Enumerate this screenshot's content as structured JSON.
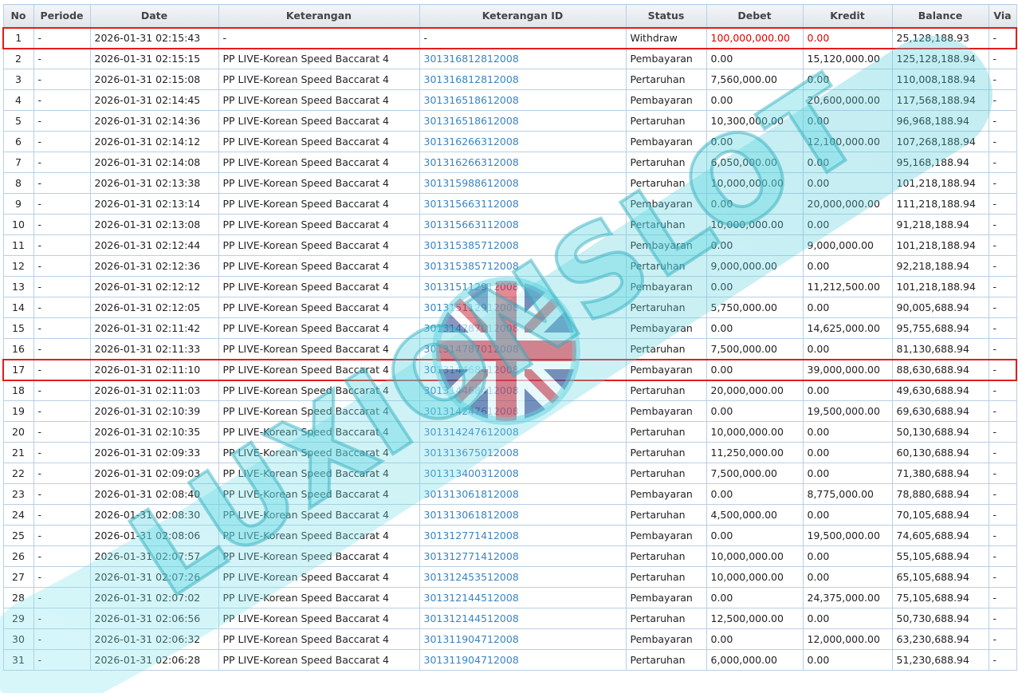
{
  "columns": [
    "No",
    "Periode",
    "Date",
    "Keterangan",
    "Keterangan ID",
    "Status",
    "Debet",
    "Kredit",
    "Balance",
    "Via"
  ],
  "highlight_color": "#e31c1c",
  "link_color": "#3a84c4",
  "watermark_text": "LUXIONSLOT",
  "rows": [
    {
      "no": "1",
      "periode": "-",
      "date": "2026-01-31 02:15:43",
      "ket": "-",
      "ket_id": "-",
      "status": "Withdraw",
      "debet": "100,000,000.00",
      "kredit": "0.00",
      "balance": "25,128,188.93",
      "via": "-",
      "highlight": true,
      "red": true
    },
    {
      "no": "2",
      "periode": "-",
      "date": "2026-01-31 02:15:15",
      "ket": "PP LIVE-Korean Speed Baccarat 4",
      "ket_id": "301316812812008",
      "status": "Pembayaran",
      "debet": "0.00",
      "kredit": "15,120,000.00",
      "balance": "125,128,188.94",
      "via": "-"
    },
    {
      "no": "3",
      "periode": "-",
      "date": "2026-01-31 02:15:08",
      "ket": "PP LIVE-Korean Speed Baccarat 4",
      "ket_id": "301316812812008",
      "status": "Pertaruhan",
      "debet": "7,560,000.00",
      "kredit": "0.00",
      "balance": "110,008,188.94",
      "via": "-"
    },
    {
      "no": "4",
      "periode": "-",
      "date": "2026-01-31 02:14:45",
      "ket": "PP LIVE-Korean Speed Baccarat 4",
      "ket_id": "301316518612008",
      "status": "Pembayaran",
      "debet": "0.00",
      "kredit": "20,600,000.00",
      "balance": "117,568,188.94",
      "via": "-"
    },
    {
      "no": "5",
      "periode": "-",
      "date": "2026-01-31 02:14:36",
      "ket": "PP LIVE-Korean Speed Baccarat 4",
      "ket_id": "301316518612008",
      "status": "Pertaruhan",
      "debet": "10,300,000.00",
      "kredit": "0.00",
      "balance": "96,968,188.94",
      "via": "-"
    },
    {
      "no": "6",
      "periode": "-",
      "date": "2026-01-31 02:14:12",
      "ket": "PP LIVE-Korean Speed Baccarat 4",
      "ket_id": "301316266312008",
      "status": "Pembayaran",
      "debet": "0.00",
      "kredit": "12,100,000.00",
      "balance": "107,268,188.94",
      "via": "-"
    },
    {
      "no": "7",
      "periode": "-",
      "date": "2026-01-31 02:14:08",
      "ket": "PP LIVE-Korean Speed Baccarat 4",
      "ket_id": "301316266312008",
      "status": "Pertaruhan",
      "debet": "6,050,000.00",
      "kredit": "0.00",
      "balance": "95,168,188.94",
      "via": "-"
    },
    {
      "no": "8",
      "periode": "-",
      "date": "2026-01-31 02:13:38",
      "ket": "PP LIVE-Korean Speed Baccarat 4",
      "ket_id": "301315988612008",
      "status": "Pertaruhan",
      "debet": "10,000,000.00",
      "kredit": "0.00",
      "balance": "101,218,188.94",
      "via": "-"
    },
    {
      "no": "9",
      "periode": "-",
      "date": "2026-01-31 02:13:14",
      "ket": "PP LIVE-Korean Speed Baccarat 4",
      "ket_id": "301315663112008",
      "status": "Pembayaran",
      "debet": "0.00",
      "kredit": "20,000,000.00",
      "balance": "111,218,188.94",
      "via": "-"
    },
    {
      "no": "10",
      "periode": "-",
      "date": "2026-01-31 02:13:08",
      "ket": "PP LIVE-Korean Speed Baccarat 4",
      "ket_id": "301315663112008",
      "status": "Pertaruhan",
      "debet": "10,000,000.00",
      "kredit": "0.00",
      "balance": "91,218,188.94",
      "via": "-"
    },
    {
      "no": "11",
      "periode": "-",
      "date": "2026-01-31 02:12:44",
      "ket": "PP LIVE-Korean Speed Baccarat 4",
      "ket_id": "301315385712008",
      "status": "Pembayaran",
      "debet": "0.00",
      "kredit": "9,000,000.00",
      "balance": "101,218,188.94",
      "via": "-"
    },
    {
      "no": "12",
      "periode": "-",
      "date": "2026-01-31 02:12:36",
      "ket": "PP LIVE-Korean Speed Baccarat 4",
      "ket_id": "301315385712008",
      "status": "Pertaruhan",
      "debet": "9,000,000.00",
      "kredit": "0.00",
      "balance": "92,218,188.94",
      "via": "-"
    },
    {
      "no": "13",
      "periode": "-",
      "date": "2026-01-31 02:12:12",
      "ket": "PP LIVE-Korean Speed Baccarat 4",
      "ket_id": "301315112912008",
      "status": "Pembayaran",
      "debet": "0.00",
      "kredit": "11,212,500.00",
      "balance": "101,218,188.94",
      "via": "-"
    },
    {
      "no": "14",
      "periode": "-",
      "date": "2026-01-31 02:12:05",
      "ket": "PP LIVE-Korean Speed Baccarat 4",
      "ket_id": "301315112912008",
      "status": "Pertaruhan",
      "debet": "5,750,000.00",
      "kredit": "0.00",
      "balance": "90,005,688.94",
      "via": "-"
    },
    {
      "no": "15",
      "periode": "-",
      "date": "2026-01-31 02:11:42",
      "ket": "PP LIVE-Korean Speed Baccarat 4",
      "ket_id": "301314787012008",
      "status": "Pembayaran",
      "debet": "0.00",
      "kredit": "14,625,000.00",
      "balance": "95,755,688.94",
      "via": "-"
    },
    {
      "no": "16",
      "periode": "-",
      "date": "2026-01-31 02:11:33",
      "ket": "PP LIVE-Korean Speed Baccarat 4",
      "ket_id": "301314787012008",
      "status": "Pertaruhan",
      "debet": "7,500,000.00",
      "kredit": "0.00",
      "balance": "81,130,688.94",
      "via": "-"
    },
    {
      "no": "17",
      "periode": "-",
      "date": "2026-01-31 02:11:10",
      "ket": "PP LIVE-Korean Speed Baccarat 4",
      "ket_id": "301314468412008",
      "status": "Pembayaran",
      "debet": "0.00",
      "kredit": "39,000,000.00",
      "balance": "88,630,688.94",
      "via": "-",
      "highlight": true
    },
    {
      "no": "18",
      "periode": "-",
      "date": "2026-01-31 02:11:03",
      "ket": "PP LIVE-Korean Speed Baccarat 4",
      "ket_id": "301314468412008",
      "status": "Pertaruhan",
      "debet": "20,000,000.00",
      "kredit": "0.00",
      "balance": "49,630,688.94",
      "via": "-"
    },
    {
      "no": "19",
      "periode": "-",
      "date": "2026-01-31 02:10:39",
      "ket": "PP LIVE-Korean Speed Baccarat 4",
      "ket_id": "301314247612008",
      "status": "Pembayaran",
      "debet": "0.00",
      "kredit": "19,500,000.00",
      "balance": "69,630,688.94",
      "via": "-"
    },
    {
      "no": "20",
      "periode": "-",
      "date": "2026-01-31 02:10:35",
      "ket": "PP LIVE-Korean Speed Baccarat 4",
      "ket_id": "301314247612008",
      "status": "Pertaruhan",
      "debet": "10,000,000.00",
      "kredit": "0.00",
      "balance": "50,130,688.94",
      "via": "-"
    },
    {
      "no": "21",
      "periode": "-",
      "date": "2026-01-31 02:09:33",
      "ket": "PP LIVE-Korean Speed Baccarat 4",
      "ket_id": "301313675012008",
      "status": "Pertaruhan",
      "debet": "11,250,000.00",
      "kredit": "0.00",
      "balance": "60,130,688.94",
      "via": "-"
    },
    {
      "no": "22",
      "periode": "-",
      "date": "2026-01-31 02:09:03",
      "ket": "PP LIVE-Korean Speed Baccarat 4",
      "ket_id": "301313400312008",
      "status": "Pertaruhan",
      "debet": "7,500,000.00",
      "kredit": "0.00",
      "balance": "71,380,688.94",
      "via": "-"
    },
    {
      "no": "23",
      "periode": "-",
      "date": "2026-01-31 02:08:40",
      "ket": "PP LIVE-Korean Speed Baccarat 4",
      "ket_id": "301313061812008",
      "status": "Pembayaran",
      "debet": "0.00",
      "kredit": "8,775,000.00",
      "balance": "78,880,688.94",
      "via": "-"
    },
    {
      "no": "24",
      "periode": "-",
      "date": "2026-01-31 02:08:30",
      "ket": "PP LIVE-Korean Speed Baccarat 4",
      "ket_id": "301313061812008",
      "status": "Pertaruhan",
      "debet": "4,500,000.00",
      "kredit": "0.00",
      "balance": "70,105,688.94",
      "via": "-"
    },
    {
      "no": "25",
      "periode": "-",
      "date": "2026-01-31 02:08:06",
      "ket": "PP LIVE-Korean Speed Baccarat 4",
      "ket_id": "301312771412008",
      "status": "Pembayaran",
      "debet": "0.00",
      "kredit": "19,500,000.00",
      "balance": "74,605,688.94",
      "via": "-"
    },
    {
      "no": "26",
      "periode": "-",
      "date": "2026-01-31 02:07:57",
      "ket": "PP LIVE-Korean Speed Baccarat 4",
      "ket_id": "301312771412008",
      "status": "Pertaruhan",
      "debet": "10,000,000.00",
      "kredit": "0.00",
      "balance": "55,105,688.94",
      "via": "-"
    },
    {
      "no": "27",
      "periode": "-",
      "date": "2026-01-31 02:07:26",
      "ket": "PP LIVE-Korean Speed Baccarat 4",
      "ket_id": "301312453512008",
      "status": "Pertaruhan",
      "debet": "10,000,000.00",
      "kredit": "0.00",
      "balance": "65,105,688.94",
      "via": "-"
    },
    {
      "no": "28",
      "periode": "-",
      "date": "2026-01-31 02:07:02",
      "ket": "PP LIVE-Korean Speed Baccarat 4",
      "ket_id": "301312144512008",
      "status": "Pembayaran",
      "debet": "0.00",
      "kredit": "24,375,000.00",
      "balance": "75,105,688.94",
      "via": "-"
    },
    {
      "no": "29",
      "periode": "-",
      "date": "2026-01-31 02:06:56",
      "ket": "PP LIVE-Korean Speed Baccarat 4",
      "ket_id": "301312144512008",
      "status": "Pertaruhan",
      "debet": "12,500,000.00",
      "kredit": "0.00",
      "balance": "50,730,688.94",
      "via": "-"
    },
    {
      "no": "30",
      "periode": "-",
      "date": "2026-01-31 02:06:32",
      "ket": "PP LIVE-Korean Speed Baccarat 4",
      "ket_id": "301311904712008",
      "status": "Pembayaran",
      "debet": "0.00",
      "kredit": "12,000,000.00",
      "balance": "63,230,688.94",
      "via": "-"
    },
    {
      "no": "31",
      "periode": "-",
      "date": "2026-01-31 02:06:28",
      "ket": "PP LIVE-Korean Speed Baccarat 4",
      "ket_id": "301311904712008",
      "status": "Pertaruhan",
      "debet": "6,000,000.00",
      "kredit": "0.00",
      "balance": "51,230,688.94",
      "via": "-"
    }
  ]
}
